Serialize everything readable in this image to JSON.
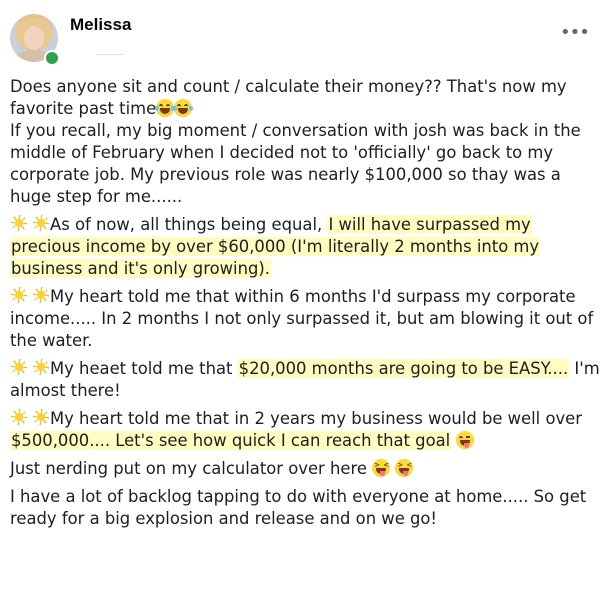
{
  "post": {
    "author": "Melissa",
    "more_icon": "•••",
    "paragraphs": {
      "p1_line1": "Does anyone sit and count / calculate their money?? That's now my",
      "p1_line2": "favorite past time",
      "p1_line3": "If you recall, my big moment / conversation with josh was back in the middle of February when I decided not to 'officially' go back to my corporate job. My previous role was nearly $100,000 so thay was a huge step for me......",
      "p2_pre": "As of now, all things being equal, ",
      "p2_hl": "I will have surpassed my precious income by over $60,000 (I'm literally 2 months into my business and it's only growing).",
      "p3": "My heart told me that within 6 months I'd surpass my corporate income..... In 2 months I not only surpassed it, but am blowing it out of the water.",
      "p4_pre": "My heaet told me that ",
      "p4_hl": "$20,000 months are going to be EASY....",
      "p4_post": " I'm almost there!",
      "p5_pre": "My heart told me that in 2 years my business would be well over ",
      "p5_hl": "$500,000.... Let's see how quick I can reach that goal",
      "p6": "Just nerding put on my calculator over here",
      "p7": "I have a lot of backlog tapping to do with everyone at home..... So get ready for a big explosion and release and on we go!"
    },
    "emojis": {
      "laughing": "face-with-tears-of-joy-icon",
      "sun": "sun-icon",
      "wink_tongue": "winking-face-with-tongue-icon",
      "squint_tongue": "squinting-face-with-tongue-icon"
    },
    "colors": {
      "highlight": "#fefcbf",
      "online": "#31a24c"
    }
  }
}
